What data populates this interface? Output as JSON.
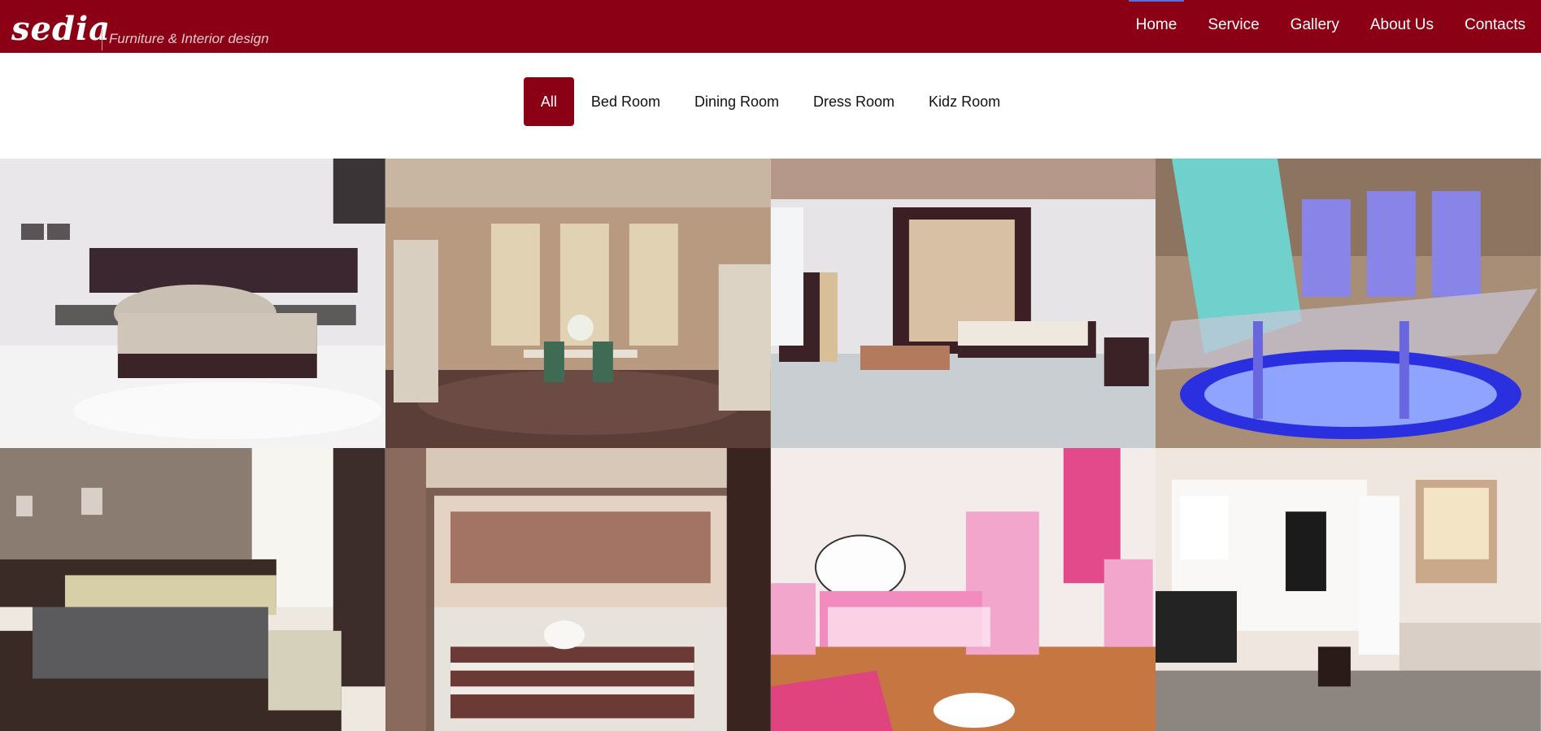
{
  "header": {
    "logo_word": "sedia",
    "logo_tagline": "Furniture & Interior design",
    "nav": [
      {
        "label": "Home",
        "active": true
      },
      {
        "label": "Service",
        "active": false
      },
      {
        "label": "Gallery",
        "active": false
      },
      {
        "label": "About Us",
        "active": false
      },
      {
        "label": "Contacts",
        "active": false
      }
    ]
  },
  "filters": [
    {
      "label": "All",
      "active": true
    },
    {
      "label": "Bed Room",
      "active": false
    },
    {
      "label": "Dining Room",
      "active": false
    },
    {
      "label": "Dress Room",
      "active": false
    },
    {
      "label": "Kidz Room",
      "active": false
    }
  ],
  "gallery": {
    "tiles": [
      {
        "subject": "bedroom-white"
      },
      {
        "subject": "dining-classic"
      },
      {
        "subject": "bedroom-wardrobe"
      },
      {
        "subject": "dining-glass-led"
      },
      {
        "subject": "bedroom-modern"
      },
      {
        "subject": "walk-in-closet"
      },
      {
        "subject": "kids-room-pink"
      },
      {
        "subject": "dress-room-white"
      }
    ]
  },
  "colors": {
    "brand": "#8b0014",
    "nav_active_indicator": "#5a6fd8"
  }
}
